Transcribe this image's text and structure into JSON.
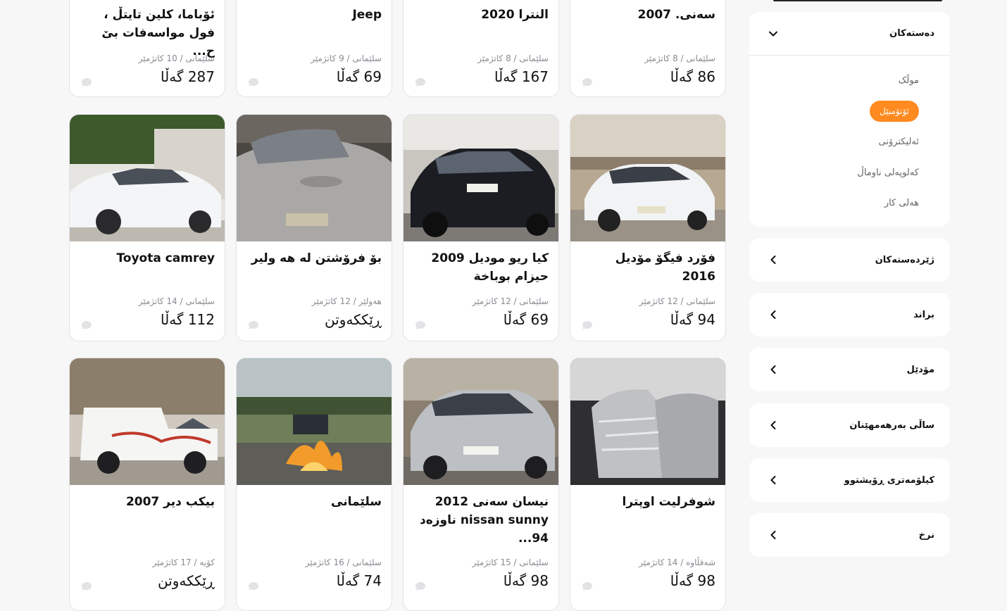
{
  "sidebar": {
    "categories": {
      "title": "دەستەکان",
      "items": [
        "موڵک",
        "ئۆتۆمبێل",
        "ئەلیکترۆنی",
        "کەلوپەلی ناوماڵ",
        "هەلی کار"
      ],
      "active_index": 1
    },
    "filters": [
      {
        "label": "ژێردەستەکان"
      },
      {
        "label": "براند"
      },
      {
        "label": "مۆدێل"
      },
      {
        "label": "ساڵی بەرهەمهێنان"
      },
      {
        "label": "کیلۆمەتری ڕۆیشتوو"
      },
      {
        "label": "نرخ"
      }
    ]
  },
  "colors": {
    "accent": "#ff8a1f",
    "card_bg": "#ffffff",
    "page_bg": "#f7f7f8"
  },
  "listings": [
    {
      "title": "سەنی. 2007",
      "meta": "سلێمانی / 8 کاتژمێر",
      "price": "86 گەڵا"
    },
    {
      "title": "النترا 2020",
      "meta": "سلێمانی / 8 کاتژمێر",
      "price": "167 گەڵا"
    },
    {
      "title": "Jeep",
      "meta": "سلێمانی / 9 کاتژمێر",
      "price": "69 گەڵا"
    },
    {
      "title": "ئۆباما، کلین تایتڵ ، فول مواسەفات بێ ح...",
      "meta": "سلێمانی / 10 کاتژمێر",
      "price": "287 گەڵا"
    },
    {
      "title": "فۆرد فیگۆ مۆدیل 2016",
      "meta": "سلێمانی / 12 کاتژمێر",
      "price": "94 گەڵا",
      "image": "white-ford-hatchback"
    },
    {
      "title": "کیا ریو مودیل 2009 حیزام بوباخة",
      "meta": "سلێمانی / 12 کاتژمێر",
      "price": "69 گەڵا",
      "image": "black-kia-rio"
    },
    {
      "title": "بۆ فرۆشتن لە هە ولیر",
      "meta": "هەولێر / 12 کاتژمێر",
      "price": "ڕێککەوتن",
      "image": "silver-toyota-yaris"
    },
    {
      "title": "Toyota camrey",
      "meta": "سلێمانی / 14 کاتژمێر",
      "price": "112 گەڵا",
      "image": "white-toyota-camry"
    },
    {
      "title": "شوفرلیت اوپترا",
      "meta": "شەقڵاوە / 14 کاتژمێر",
      "price": "98 گەڵا",
      "image": "car-interior-seats"
    },
    {
      "title": "نیسان سەنی 2012 nissan sunny ناوزەد 94...",
      "meta": "سلێمانی / 15 کاتژمێر",
      "price": "98 گەڵا",
      "image": "silver-nissan-sunny"
    },
    {
      "title": "سلێمانی",
      "meta": "سلێمانی / 16 کاتژمێر",
      "price": "74 گەڵا",
      "image": "campfire-jeep-field"
    },
    {
      "title": "بیکب دیر 2007",
      "meta": "کۆیە / 17 کاتژمێر",
      "price": "ڕێککەوتن",
      "image": "white-pickup-truck"
    }
  ]
}
